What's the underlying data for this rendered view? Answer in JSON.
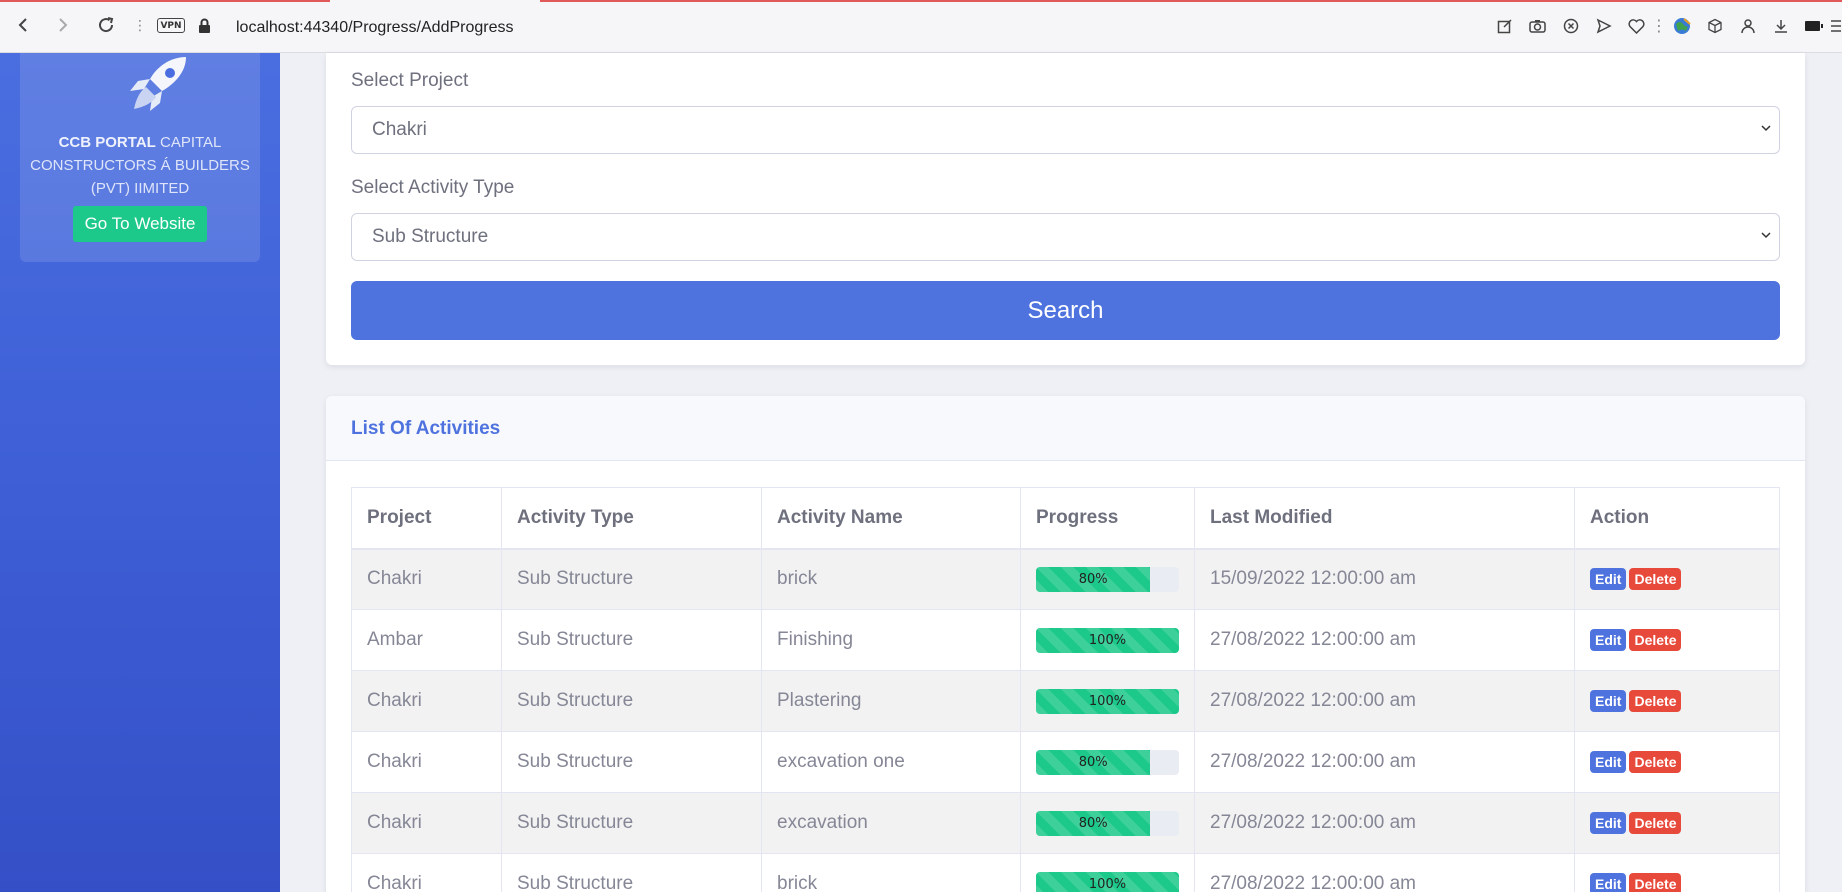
{
  "browser": {
    "url": "localhost:44340/Progress/AddProgress",
    "vpn_label": "VPN"
  },
  "sidebar": {
    "brand_bold": "CCB PORTAL",
    "brand_rest": " CAPITAL CONSTRUCTORS Á BUILDERS (PVT) IIMITED",
    "website_button": "Go To Website"
  },
  "form": {
    "project_label": "Select Project",
    "project_value": "Chakri",
    "activity_type_label": "Select Activity Type",
    "activity_type_value": "Sub Structure",
    "search_button": "Search"
  },
  "list": {
    "title": "List Of Activities",
    "columns": [
      "Project",
      "Activity Type",
      "Activity Name",
      "Progress",
      "Last Modified",
      "Action"
    ],
    "edit_label": "Edit",
    "delete_label": "Delete",
    "rows": [
      {
        "project": "Chakri",
        "activity_type": "Sub Structure",
        "activity_name": "brick",
        "progress": 80,
        "progress_label": "80%",
        "last_modified": "15/09/2022 12:00:00 am"
      },
      {
        "project": "Ambar",
        "activity_type": "Sub Structure",
        "activity_name": "Finishing",
        "progress": 100,
        "progress_label": "100%",
        "last_modified": "27/08/2022 12:00:00 am"
      },
      {
        "project": "Chakri",
        "activity_type": "Sub Structure",
        "activity_name": "Plastering",
        "progress": 100,
        "progress_label": "100%",
        "last_modified": "27/08/2022 12:00:00 am"
      },
      {
        "project": "Chakri",
        "activity_type": "Sub Structure",
        "activity_name": "excavation one",
        "progress": 80,
        "progress_label": "80%",
        "last_modified": "27/08/2022 12:00:00 am"
      },
      {
        "project": "Chakri",
        "activity_type": "Sub Structure",
        "activity_name": "excavation",
        "progress": 80,
        "progress_label": "80%",
        "last_modified": "27/08/2022 12:00:00 am"
      },
      {
        "project": "Chakri",
        "activity_type": "Sub Structure",
        "activity_name": "brick",
        "progress": 100,
        "progress_label": "100%",
        "last_modified": "27/08/2022 12:00:00 am"
      }
    ]
  },
  "colors": {
    "primary": "#4e73df",
    "success": "#1cc88a",
    "danger": "#e74a3b"
  }
}
